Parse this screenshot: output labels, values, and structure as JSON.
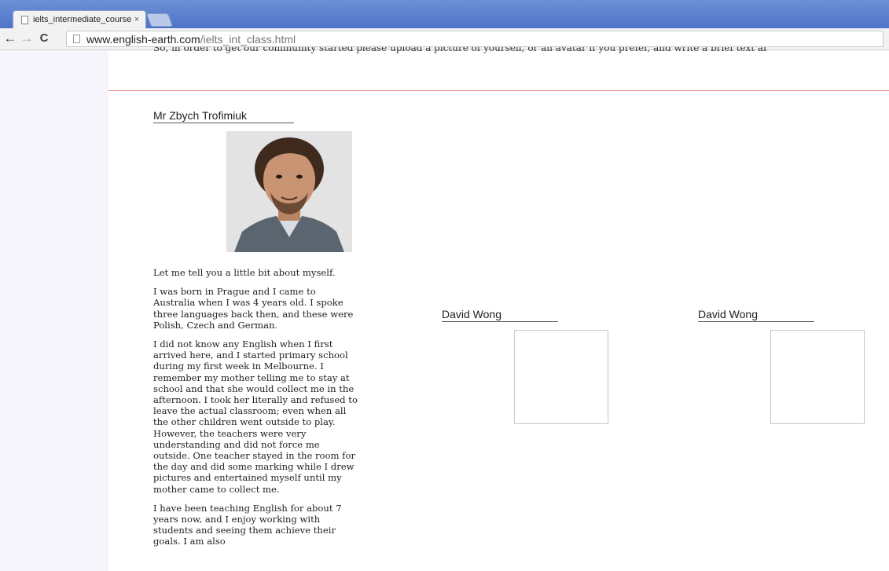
{
  "browser": {
    "tab_title": "ielts_intermediate_course",
    "tab_close": "×",
    "url_host": "www.english-earth.com",
    "url_path": "/ielts_int_class.html"
  },
  "page": {
    "cut_off_text": "So, in order to get our community started please upload a picture of yourself, or an avatar if you prefer, and write a brief text about yourself.",
    "profile": {
      "name": "Mr Zbych Trofimiuk",
      "bio": [
        "Let me tell you a little bit about myself.",
        "I was born in Prague and I came to Australia when I was 4 years old. I spoke three languages back then, and these were Polish, Czech and German.",
        "I did not know any English when I first arrived here, and I started primary school during my first week in Melbourne. I remember my mother telling me to stay at school and that she would collect me in the afternoon. I took her literally and refused to leave the actual classroom; even when all the other children went outside to play. However, the teachers were very understanding and did not force me outside. One teacher stayed in the room for the day and did some marking while I drew pictures and entertained myself until my mother came to collect me.",
        "I have been teaching English for about 7 years now, and I enjoy working with students and seeing them achieve their goals. I am also"
      ]
    },
    "students": [
      {
        "name": "David Wong"
      },
      {
        "name": "David Wong"
      }
    ]
  },
  "colors": {
    "tabstrip": "#4f74c8",
    "divider": "#e07a7a"
  }
}
